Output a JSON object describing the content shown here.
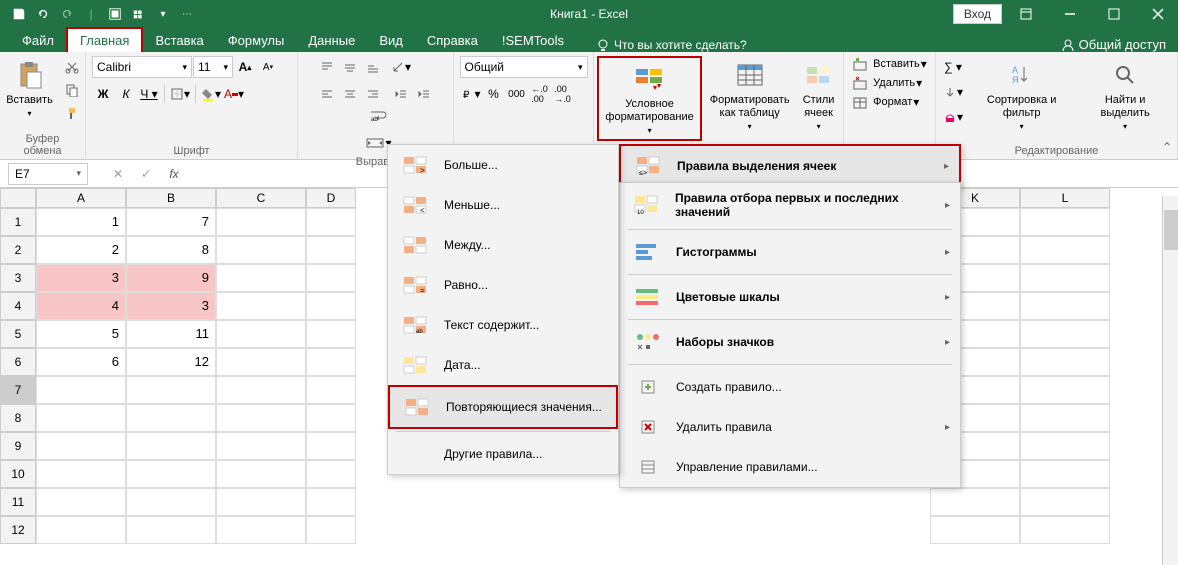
{
  "titlebar": {
    "title": "Книга1 - Excel",
    "signin": "Вход"
  },
  "tabs": {
    "file": "Файл",
    "home": "Главная",
    "insert": "Вставка",
    "formulas": "Формулы",
    "data": "Данные",
    "view": "Вид",
    "help": "Справка",
    "semtools": "!SEMTools",
    "tellme": "Что вы хотите сделать?",
    "share": "Общий доступ"
  },
  "ribbon": {
    "clipboard": {
      "paste": "Вставить",
      "label": "Буфер обмена"
    },
    "font": {
      "name": "Calibri",
      "size": "11",
      "label": "Шрифт"
    },
    "alignment": {
      "label": "Выравн"
    },
    "number": {
      "format": "Общий"
    },
    "styles": {
      "cf": "Условное форматирование",
      "table": "Форматировать как таблицу",
      "cell": "Стили ячеек"
    },
    "cells": {
      "insert": "Вставить",
      "delete": "Удалить",
      "format": "Формат"
    },
    "editing": {
      "sort": "Сортировка и фильтр",
      "find": "Найти и выделить",
      "label": "Редактирование"
    }
  },
  "formulabar": {
    "namebox": "E7"
  },
  "grid": {
    "cols": [
      "A",
      "B",
      "C",
      "D",
      "",
      "",
      "",
      "",
      "",
      "K",
      "L"
    ],
    "rows": [
      {
        "n": "1",
        "a": "1",
        "b": "7",
        "hl": false
      },
      {
        "n": "2",
        "a": "2",
        "b": "8",
        "hl": false
      },
      {
        "n": "3",
        "a": "3",
        "b": "9",
        "hl": true
      },
      {
        "n": "4",
        "a": "4",
        "b": "3",
        "hl": true
      },
      {
        "n": "5",
        "a": "5",
        "b": "11",
        "hl": false
      },
      {
        "n": "6",
        "a": "6",
        "b": "12",
        "hl": false
      },
      {
        "n": "7",
        "a": "",
        "b": "",
        "hl": false,
        "sel": true
      },
      {
        "n": "8",
        "a": "",
        "b": "",
        "hl": false
      },
      {
        "n": "9",
        "a": "",
        "b": "",
        "hl": false
      },
      {
        "n": "10",
        "a": "",
        "b": "",
        "hl": false
      },
      {
        "n": "11",
        "a": "",
        "b": "",
        "hl": false
      },
      {
        "n": "12",
        "a": "",
        "b": "",
        "hl": false
      }
    ]
  },
  "menu1": {
    "greater": "Больше...",
    "less": "Меньше...",
    "between": "Между...",
    "equal": "Равно...",
    "text": "Текст содержит...",
    "date": "Дата...",
    "dup": "Повторяющиеся значения...",
    "other": "Другие правила..."
  },
  "menu2": {
    "highlight": "Правила выделения ячеек",
    "top": "Правила отбора первых и последних значений",
    "bars": "Гистограммы",
    "scales": "Цветовые шкалы",
    "icons": "Наборы значков",
    "new": "Создать правило...",
    "clear": "Удалить правила",
    "manage": "Управление правилами..."
  }
}
